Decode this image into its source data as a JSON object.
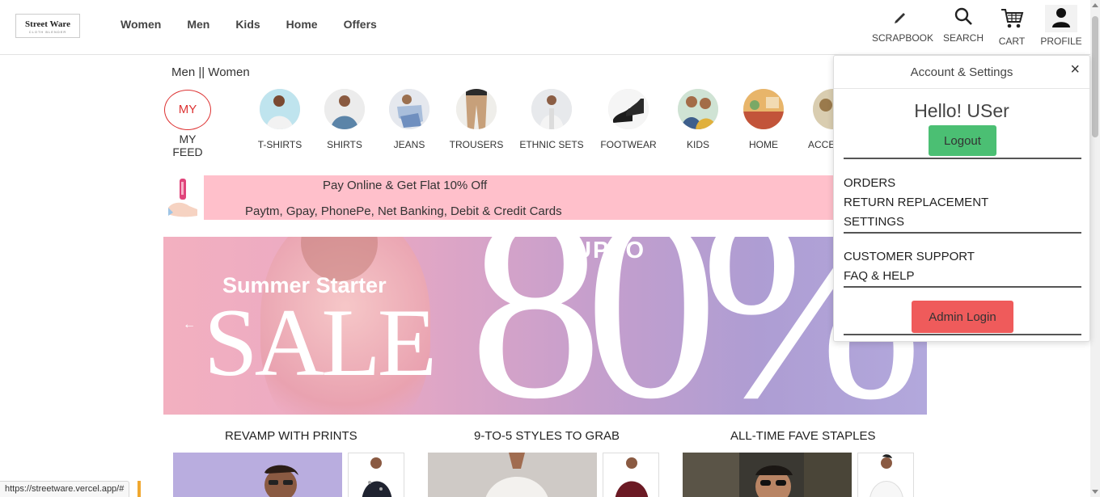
{
  "header": {
    "logo": {
      "name": "Street Ware",
      "tagline": "CLOTH BLENDER"
    },
    "nav": [
      "Women",
      "Men",
      "Kids",
      "Home",
      "Offers"
    ],
    "tools": {
      "scrapbook": "SCRAPBOOK",
      "search": "SEARCH",
      "cart": "CART",
      "profile": "PROFILE"
    }
  },
  "gender_switch": "Men || Women",
  "my_feed": {
    "circle": "MY",
    "label": "MY FEED"
  },
  "categories": [
    "T-SHIRTS",
    "SHIRTS",
    "JEANS",
    "TROUSERS",
    "ETHNIC SETS",
    "FOOTWEAR",
    "KIDS",
    "HOME",
    "ACCES"
  ],
  "offer": {
    "line1": "Pay Online & Get Flat 10% Off",
    "line2": "Paytm, Gpay, PhonePe, Net Banking, Debit & Credit Cards"
  },
  "banner": {
    "title": "Summer Starter",
    "sale": "SALE",
    "upto": "UPTO",
    "big": "80%"
  },
  "sections": [
    "REVAMP WITH PRINTS",
    "9-TO-5 STYLES TO GRAB",
    "ALL-TIME FAVE STAPLES"
  ],
  "status_url": "https://streetware.vercel.app/#",
  "profile_panel": {
    "title": "Account & Settings",
    "greeting": "Hello! USer",
    "logout": "Logout",
    "group1": [
      "ORDERS",
      "RETURN REPLACEMENT",
      "SETTINGS"
    ],
    "group2": [
      "CUSTOMER SUPPORT",
      "FAQ & HELP"
    ],
    "admin": "Admin Login"
  },
  "colors": {
    "logout": "#4bbf73",
    "admin": "#ef5b5b",
    "offer_bg": "#ffc0cb",
    "my_feed": "#d33333"
  }
}
